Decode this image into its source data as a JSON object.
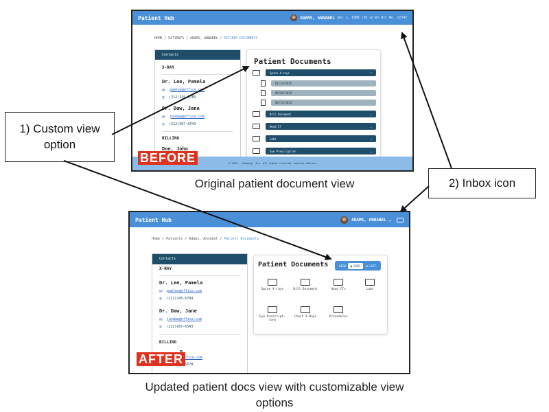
{
  "app": {
    "title": "Patient Hub",
    "patient_before": "ADAMS, ANNABEL",
    "patient_info": "Dec 1, 1988 (36 yo W) Acc No. 12345",
    "patient_after": "ADAMS, ANNABEL ⌄"
  },
  "before": {
    "breadcrumb": [
      "HOME",
      "PATIENTS",
      "ADAMS, ANNABEL"
    ],
    "breadcrumb_active": "PATIENT DOCUMENTS",
    "footer": "© 2025 - Company, Inc. All rights reserved. Address Address",
    "badge": "BEFORE"
  },
  "after": {
    "breadcrumb": [
      "Home",
      "Patients",
      "Adams, Annabel"
    ],
    "breadcrumb_active": "Patient Documents",
    "badge": "AFTER"
  },
  "contacts": {
    "header": "Contacts",
    "xray_section": "X-RAY",
    "billing_section": "BILLING",
    "people": [
      {
        "name": "Dr. Lee, Pamela",
        "email": "pamlee@office.com",
        "phone": "(212)345-6789"
      },
      {
        "name": "Dr. Daw, Jane",
        "email": "jandaw@office.com",
        "phone": "(212)987-6543"
      }
    ],
    "billing_partial_before": "Doe, John",
    "billing_partial_after": "n",
    "billing_email": "@office.com",
    "billing_phone": "(321)234-5678"
  },
  "documents": {
    "title": "Patient Documents",
    "before_folders": [
      "Spine X-rays",
      "Bill Document",
      "Head CT",
      "Labs",
      "Eye Prescription"
    ],
    "spine_files": [
      "01/14/2025",
      "08/05/2024",
      "04/13/2024"
    ],
    "view_toggle": {
      "label": "VIEW",
      "grid": "GRID",
      "list": "LIST"
    },
    "grid_folders": [
      "Spine X-rays",
      "Bill Document",
      "Head CTs",
      "Labs",
      "Eye Prescript-ions",
      "Chest X-Rays",
      "Procedures"
    ]
  },
  "annotations": {
    "callout1": "1) Custom view option",
    "callout2": "2) Inbox icon",
    "caption_before": "Original patient document view",
    "caption_after": "Updated patient docs view with customizable view options"
  },
  "colors": {
    "appbar": "#4a90d9",
    "navy": "#1f4e6b",
    "subrow": "#9eb3bd",
    "footer": "#8bbbe6",
    "badge": "#e0301e"
  }
}
